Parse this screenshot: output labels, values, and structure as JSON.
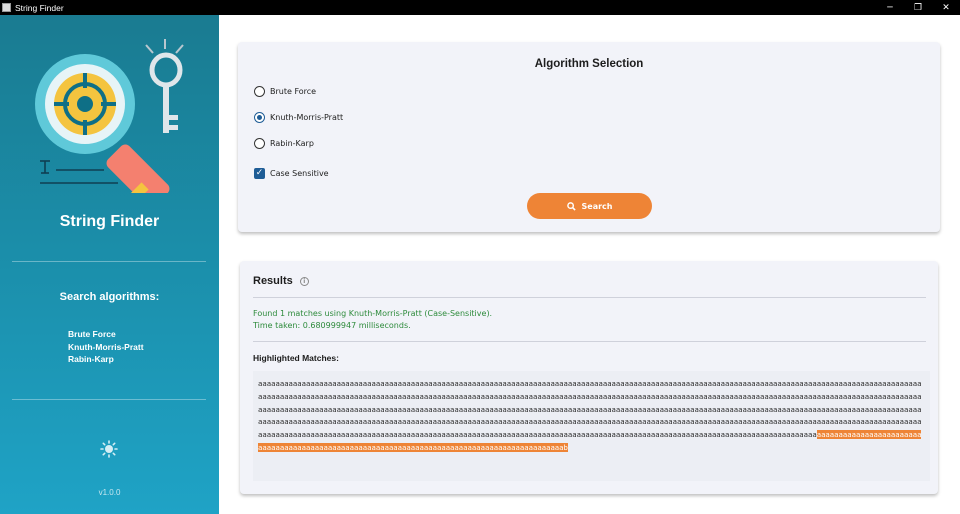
{
  "window": {
    "title": "String Finder",
    "controls": {
      "minimize": "─",
      "maximize": "❐",
      "close": "✕"
    }
  },
  "sidebar": {
    "brand": "String Finder",
    "algorithms_heading": "Search algorithms:",
    "algorithms": [
      "Brute Force",
      "Knuth-Morris-Pratt",
      "Rabin-Karp"
    ],
    "theme_icon": "sun-icon",
    "version": "v1.0.0"
  },
  "algorithm_selection": {
    "title": "Algorithm Selection",
    "options": [
      {
        "label": "Brute Force",
        "selected": false
      },
      {
        "label": "Knuth-Morris-Pratt",
        "selected": true
      },
      {
        "label": "Rabin-Karp",
        "selected": false
      }
    ],
    "case_sensitive": {
      "label": "Case Sensitive",
      "checked": true
    },
    "search_button": {
      "label": "Search",
      "icon": "search-icon"
    }
  },
  "results": {
    "title": "Results",
    "info_icon": "info-icon",
    "status_line": "Found 1 matches using Knuth-Morris-Pratt (Case-Sensitive).",
    "time_line": "Time taken: 0.680999947 milliseconds.",
    "highlighted_label": "Highlighted Matches:",
    "text_before_match": "aaaaaaaaaaaaaaaaaaaaaaaaaaaaaaaaaaaaaaaaaaaaaaaaaaaaaaaaaaaaaaaaaaaaaaaaaaaaaaaaaaaaaaaaaaaaaaaaaaaaaaaaaaaaaaaaaaaaaaaaaaaaaaaaaaaaaaaaaaaaaaaaaaaaaaaaaaaaaaaaaaaaaaaaaaaaaaaaaaaaaaaaaaaaaaaaaaaaaaaaaaaaaaaaaaaaaaaaaaaaaaaaaaaaaaaaaaaaaaaaaaaaaaaaaaaaaaaaaaaaaaaaaaaaaaaaaaaaaaaaaaaaaaaaaaaaaaaaaaaaaaaaaaaaaaaaaaaaaaaaaaaaaaaaaaaaaaaaaaaaaaaaaaaaaaaaaaaaaaaaaaaaaaaaaaaaaaaaaaaaaaaaaaaaaaaaaaaaaaaaaaaaaaaaaaaaaaaaaaaaaaaaaaaaaaaaaaaaaaaaaaaaaaaaaaaaaaaaaaaaaaaaaaaaaaaaaaaaaaaaaaaaaaaaaaaaaaaaaaaaaaaaaaaaaaaaaaaaaaaaaaaaaaaaaaaaaaaaaaaaaaaaaaaaaaaaaaaaaaaaaaaaaaaaaaaaaaaaaaaaaaaaaaaaaaaaaaaaaaaaaaaaaaaaaaaaaaaaaaaaaaaaaaaaaaaaaaaaaaaaaaaaaaaaaaaaaaaaaaaaaaaaaaaaaaaaaaaaaaaaaaaaaaaaaaaaaaaaaaaaaaaaaaaaaaaaaaaaaaaaaaaaaaaaaaaaaaaa",
    "match_text": "aaaaaaaaaaaaaaaaaaaaaaaaaaaaaaaaaaaaaaaaaaaaaaaaaaaaaaaaaaaaaaaaaaaaaaaaaaaaaaaaaaaaaaaaaaaaaab"
  },
  "colors": {
    "accent": "#ee8436",
    "sidebar_top": "#1a7b91",
    "sidebar_bottom": "#1fa3c6",
    "success_text": "#2e8b3c",
    "radio_selected": "#1e5c96"
  }
}
